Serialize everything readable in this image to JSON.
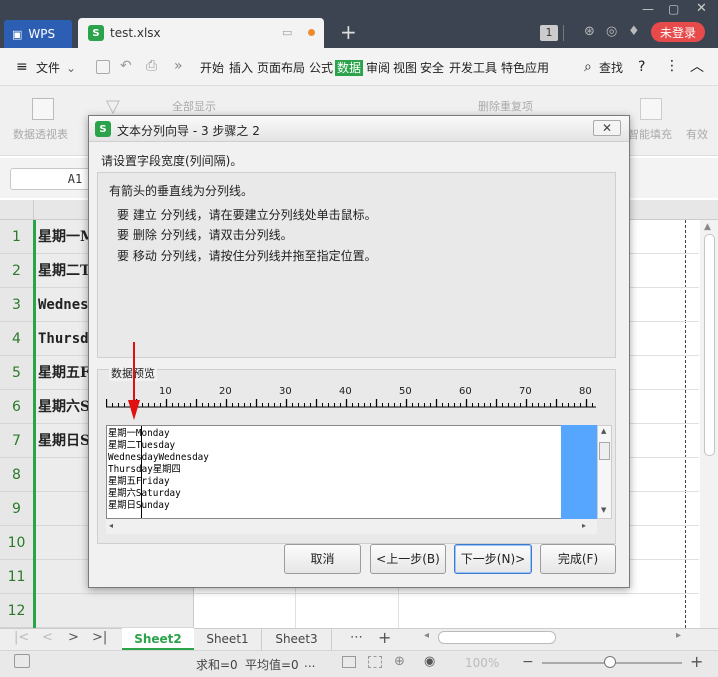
{
  "titlebar": {
    "app_tab": "WPS",
    "file_tab": "test.xlsx",
    "page_badge": "1",
    "login": "未登录"
  },
  "menubar": {
    "file_menu": "文件",
    "items": [
      "开始",
      "插入",
      "页面布局",
      "公式",
      "数据",
      "审阅",
      "视图",
      "安全",
      "开发工具",
      "特色应用"
    ],
    "active": "数据",
    "search": "查找"
  },
  "ribbon": {
    "pivot": "数据透视表",
    "show_all": "全部显示",
    "remove_dup": "删除重复项",
    "smart_fill": "智能填充",
    "valid": "有效"
  },
  "formula_bar": {
    "cell_ref": "A1"
  },
  "grid": {
    "rows": [
      "1",
      "2",
      "3",
      "4",
      "5",
      "6",
      "7",
      "8",
      "9",
      "10",
      "11",
      "12"
    ],
    "colA": [
      "星期一M",
      "星期二T",
      "Wednes",
      "Thursd",
      "星期五F",
      "星期六S",
      "星期日S",
      "",
      "",
      "",
      "",
      ""
    ]
  },
  "sheets": {
    "tabs": [
      "Sheet2",
      "Sheet1",
      "Sheet3"
    ],
    "active": "Sheet2"
  },
  "statusbar": {
    "sum": "求和=0",
    "avg": "平均值=0",
    "more": "...",
    "zoom": "100%"
  },
  "dialog": {
    "title": "文本分列向导 - 3 步骤之 2",
    "prompt": "请设置字段宽度(列间隔)。",
    "desc": "有箭头的垂直线为分列线。",
    "hint_create": "要 建立 分列线，请在要建立分列线处单击鼠标。",
    "hint_delete": "要 删除 分列线，请双击分列线。",
    "hint_move": "要 移动 分列线，请按住分列线并拖至指定位置。",
    "preview_label": "数据预览",
    "ruler_ticks": [
      "10",
      "20",
      "30",
      "40",
      "50",
      "60",
      "70",
      "80"
    ],
    "preview_lines": [
      "星期一Monday",
      "星期二Tuesday",
      "WednesdayWednesday",
      "Thursday星期四",
      "星期五Friday",
      "星期六Saturday",
      "星期日Sunday"
    ],
    "buttons": {
      "cancel": "取消",
      "back": "<上一步(B)",
      "next": "下一步(N)>",
      "finish": "完成(F)"
    }
  }
}
